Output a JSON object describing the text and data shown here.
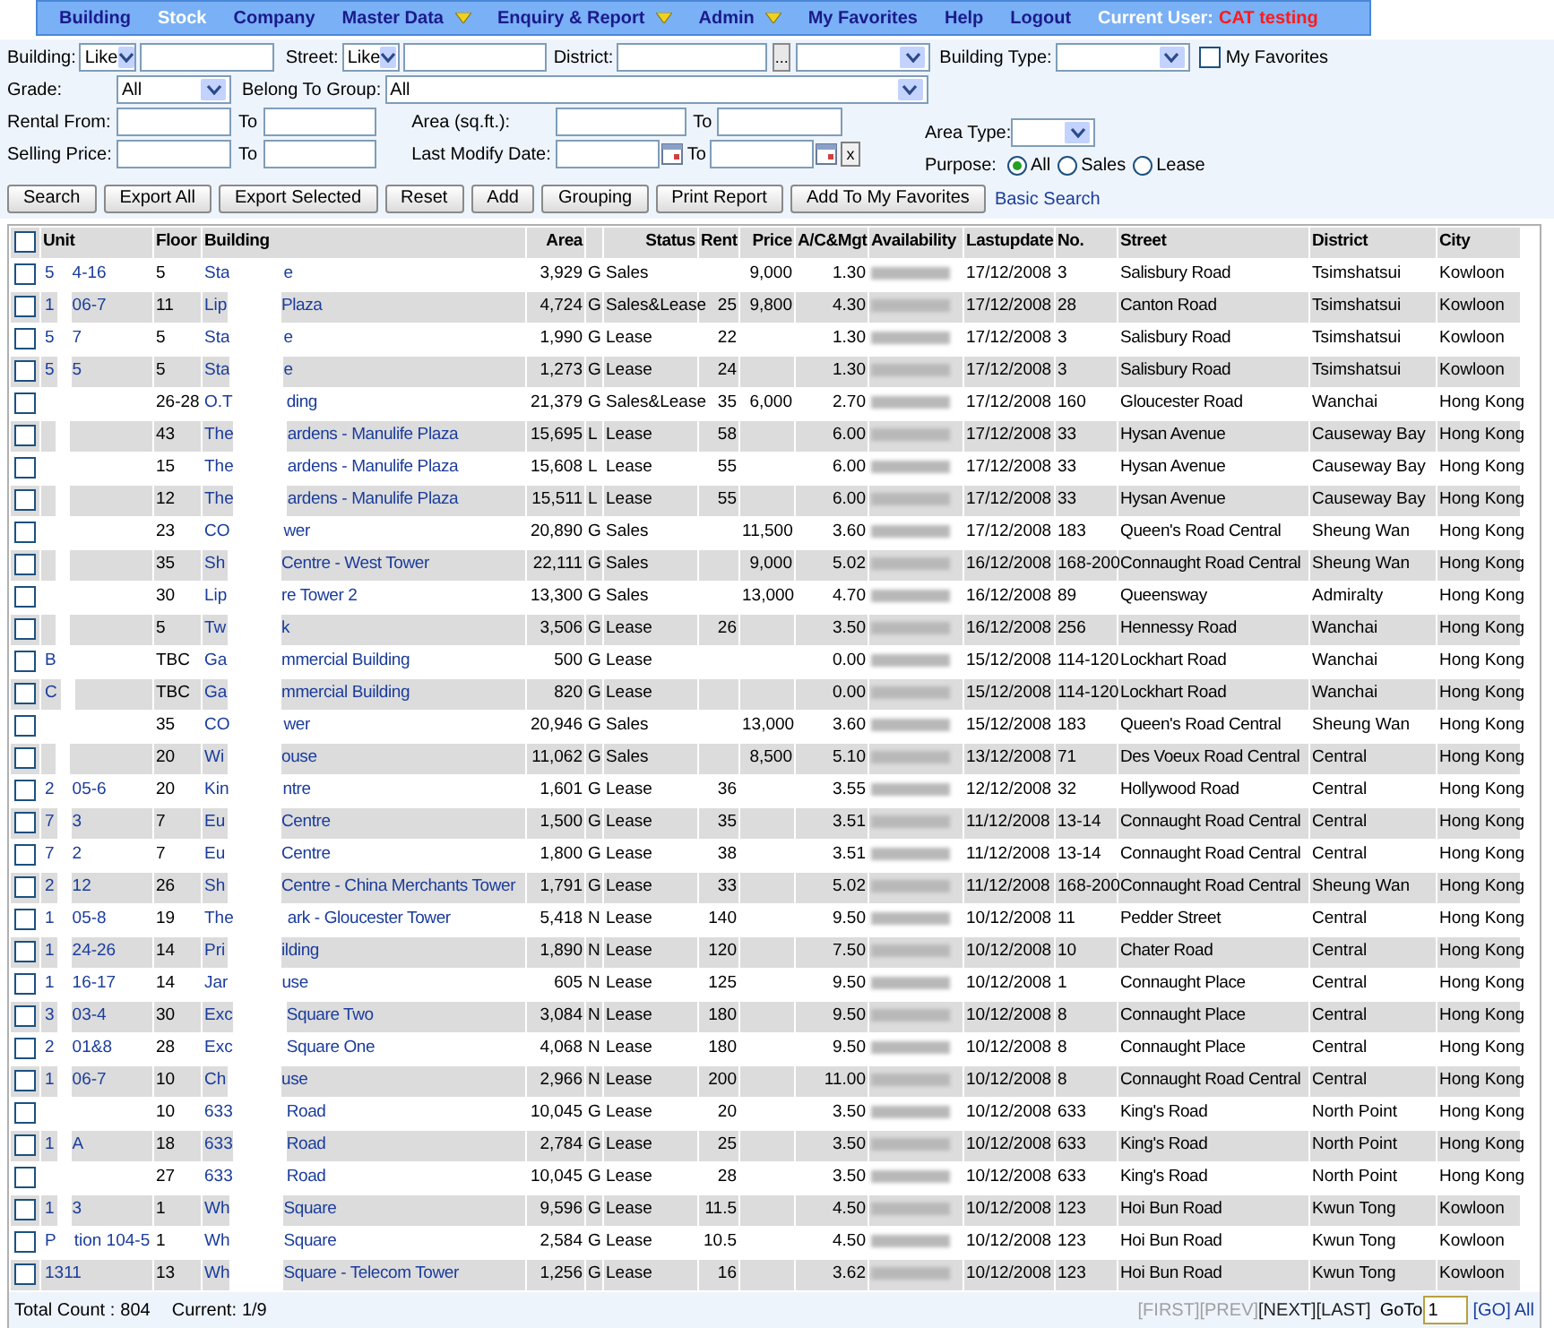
{
  "nav": {
    "items": [
      {
        "label": "Building",
        "selected": false,
        "dropdown": false
      },
      {
        "label": "Stock",
        "selected": true,
        "dropdown": false
      },
      {
        "label": "Company",
        "selected": false,
        "dropdown": false
      },
      {
        "label": "Master Data",
        "selected": false,
        "dropdown": true
      },
      {
        "label": "Enquiry & Report",
        "selected": false,
        "dropdown": true
      },
      {
        "label": "Admin",
        "selected": false,
        "dropdown": true
      },
      {
        "label": "My Favorites",
        "selected": false,
        "dropdown": false
      },
      {
        "label": "Help",
        "selected": false,
        "dropdown": false
      },
      {
        "label": "Logout",
        "selected": false,
        "dropdown": false
      }
    ],
    "current_user_label": "Current User:",
    "current_user": "CAT testing"
  },
  "filters": {
    "building_label": "Building:",
    "building_op": "Like",
    "street_label": "Street:",
    "street_op": "Like",
    "district_label": "District:",
    "district_button": "...",
    "building_type_label": "Building Type:",
    "my_favorites": {
      "label": "My Favorites",
      "checked": false
    },
    "grade_label": "Grade:",
    "grade": "All",
    "group_label": "Belong To Group:",
    "group": "All",
    "rental_label": "Rental From:",
    "rental_to_label": "To",
    "area_label": "Area (sq.ft.):",
    "area_to_label": "To",
    "selling_label": "Selling Price:",
    "selling_to_label": "To",
    "date_label": "Last Modify Date:",
    "date_to_label": "To",
    "clear_button": "x",
    "area_type_label": "Area Type:",
    "purpose_label": "Purpose:",
    "purpose_options": [
      {
        "label": "All",
        "selected": true
      },
      {
        "label": "Sales",
        "selected": false
      },
      {
        "label": "Lease",
        "selected": false
      }
    ]
  },
  "buttons": [
    "Search",
    "Export All",
    "Export Selected",
    "Reset",
    "Add",
    "Grouping",
    "Print Report",
    "Add To My Favorites"
  ],
  "basic_search": "Basic Search",
  "table": {
    "select_all_checked": false,
    "columns": [
      "Unit",
      "Floor",
      "Building",
      "Area",
      "Status",
      "Rent",
      "Price",
      "A/C&Mgt",
      "Availability",
      "Lastupdate",
      "No.",
      "Street",
      "District",
      "City"
    ],
    "rows": [
      {
        "checked": false,
        "unit_masked": true,
        "unit_a": "5",
        "unit_b": "4-16",
        "floor": "5",
        "bldg_a": "Sta",
        "bldg_b": "e",
        "area": "3,929",
        "grade": "G",
        "status": "Sales",
        "price": "9,000",
        "acm": "1.30",
        "updated": "17/12/2008",
        "no": "3",
        "street": "Salisbury Road",
        "district": "Tsimshatsui",
        "city": "Kowloon"
      },
      {
        "checked": false,
        "unit_masked": true,
        "unit_a": "1",
        "unit_b": "06-7",
        "floor": "11",
        "bldg_a": "Lip",
        "bldg_b": "Plaza",
        "area": "4,724",
        "grade": "G",
        "status": "Sales&Lease",
        "rent": "25",
        "price": "9,800",
        "acm": "4.30",
        "updated": "17/12/2008",
        "no": "28",
        "street": "Canton Road",
        "district": "Tsimshatsui",
        "city": "Kowloon"
      },
      {
        "checked": false,
        "unit_masked": true,
        "unit_a": "5",
        "unit_b": "7",
        "floor": "5",
        "bldg_a": "Sta",
        "bldg_b": "e",
        "area": "1,990",
        "grade": "G",
        "status": "Lease",
        "rent": "22",
        "acm": "1.30",
        "updated": "17/12/2008",
        "no": "3",
        "street": "Salisbury Road",
        "district": "Tsimshatsui",
        "city": "Kowloon"
      },
      {
        "checked": false,
        "unit_masked": true,
        "unit_a": "5",
        "unit_b": "5",
        "floor": "5",
        "bldg_a": "Sta",
        "bldg_b": "e",
        "area": "1,273",
        "grade": "G",
        "status": "Lease",
        "rent": "24",
        "acm": "1.30",
        "updated": "17/12/2008",
        "no": "3",
        "street": "Salisbury Road",
        "district": "Tsimshatsui",
        "city": "Kowloon"
      },
      {
        "checked": false,
        "unit_masked": true,
        "floor": "26-28",
        "bldg_a": "O.T",
        "bldg_b": "ding",
        "area": "21,379",
        "grade": "G",
        "status": "Sales&Lease",
        "rent": "35",
        "price": "6,000",
        "acm": "2.70",
        "updated": "17/12/2008",
        "no": "160",
        "street": "Gloucester Road",
        "district": "Wanchai",
        "city": "Hong Kong"
      },
      {
        "checked": false,
        "unit_masked": true,
        "floor": "43",
        "bldg_a": "The",
        "bldg_b": "ardens - Manulife Plaza",
        "area": "15,695",
        "grade": "L",
        "status": "Lease",
        "rent": "58",
        "acm": "6.00",
        "updated": "17/12/2008",
        "no": "33",
        "street": "Hysan Avenue",
        "district": "Causeway Bay",
        "city": "Hong Kong"
      },
      {
        "checked": false,
        "unit_masked": true,
        "floor": "15",
        "bldg_a": "The",
        "bldg_b": "ardens - Manulife Plaza",
        "area": "15,608",
        "grade": "L",
        "status": "Lease",
        "rent": "55",
        "acm": "6.00",
        "updated": "17/12/2008",
        "no": "33",
        "street": "Hysan Avenue",
        "district": "Causeway Bay",
        "city": "Hong Kong"
      },
      {
        "checked": false,
        "unit_masked": true,
        "floor": "12",
        "bldg_a": "The",
        "bldg_b": "ardens - Manulife Plaza",
        "area": "15,511",
        "grade": "L",
        "status": "Lease",
        "rent": "55",
        "acm": "6.00",
        "updated": "17/12/2008",
        "no": "33",
        "street": "Hysan Avenue",
        "district": "Causeway Bay",
        "city": "Hong Kong"
      },
      {
        "checked": false,
        "unit_masked": true,
        "floor": "23",
        "bldg_a": "CO",
        "bldg_b": "wer",
        "area": "20,890",
        "grade": "G",
        "status": "Sales",
        "price": "11,500",
        "acm": "3.60",
        "updated": "17/12/2008",
        "no": "183",
        "street": "Queen's Road Central",
        "district": "Sheung Wan",
        "city": "Hong Kong"
      },
      {
        "checked": false,
        "unit_masked": true,
        "floor": "35",
        "bldg_a": "Sh",
        "bldg_b": "Centre - West Tower",
        "area": "22,111",
        "grade": "G",
        "status": "Sales",
        "price": "9,000",
        "acm": "5.02",
        "updated": "16/12/2008",
        "no": "168-200",
        "street": "Connaught Road Central",
        "district": "Sheung Wan",
        "city": "Hong Kong"
      },
      {
        "checked": false,
        "unit_masked": true,
        "floor": "30",
        "bldg_a": "Lip",
        "bldg_b": "re Tower 2",
        "area": "13,300",
        "grade": "G",
        "status": "Sales",
        "price": "13,000",
        "acm": "4.70",
        "updated": "16/12/2008",
        "no": "89",
        "street": "Queensway",
        "district": "Admiralty",
        "city": "Hong Kong"
      },
      {
        "checked": false,
        "unit_masked": true,
        "floor": "5",
        "bldg_a": "Tw",
        "bldg_b": "k",
        "area": "3,506",
        "grade": "G",
        "status": "Lease",
        "rent": "26",
        "acm": "3.50",
        "updated": "16/12/2008",
        "no": "256",
        "street": "Hennessy Road",
        "district": "Wanchai",
        "city": "Hong Kong"
      },
      {
        "checked": false,
        "unit_masked": true,
        "unit_a": "B",
        "floor": "TBC",
        "bldg_a": "Ga",
        "bldg_b": "mmercial Building",
        "area": "500",
        "grade": "G",
        "status": "Lease",
        "acm": "0.00",
        "updated": "15/12/2008",
        "no": "114-120",
        "street": "Lockhart Road",
        "district": "Wanchai",
        "city": "Hong Kong"
      },
      {
        "checked": false,
        "unit_masked": true,
        "unit_a": "C",
        "floor": "TBC",
        "bldg_a": "Ga",
        "bldg_b": "mmercial Building",
        "area": "820",
        "grade": "G",
        "status": "Lease",
        "acm": "0.00",
        "updated": "15/12/2008",
        "no": "114-120",
        "street": "Lockhart Road",
        "district": "Wanchai",
        "city": "Hong Kong"
      },
      {
        "checked": false,
        "unit_masked": true,
        "floor": "35",
        "bldg_a": "CO",
        "bldg_b": "wer",
        "area": "20,946",
        "grade": "G",
        "status": "Sales",
        "price": "13,000",
        "acm": "3.60",
        "updated": "15/12/2008",
        "no": "183",
        "street": "Queen's Road Central",
        "district": "Sheung Wan",
        "city": "Hong Kong"
      },
      {
        "checked": false,
        "unit_masked": true,
        "floor": "20",
        "bldg_a": "Wi",
        "bldg_b": "ouse",
        "area": "11,062",
        "grade": "G",
        "status": "Sales",
        "price": "8,500",
        "acm": "5.10",
        "updated": "13/12/2008",
        "no": "71",
        "street": "Des Voeux Road Central",
        "district": "Central",
        "city": "Hong Kong"
      },
      {
        "checked": false,
        "unit_masked": true,
        "unit_a": "2",
        "unit_b": "05-6",
        "floor": "20",
        "bldg_a": "Kin",
        "bldg_b": "ntre",
        "area": "1,601",
        "grade": "G",
        "status": "Lease",
        "rent": "36",
        "acm": "3.55",
        "updated": "12/12/2008",
        "no": "32",
        "street": "Hollywood Road",
        "district": "Central",
        "city": "Hong Kong"
      },
      {
        "checked": false,
        "unit_masked": true,
        "unit_a": "7",
        "unit_b": "3",
        "floor": "7",
        "bldg_a": "Eu",
        "bldg_b": "Centre",
        "area": "1,500",
        "grade": "G",
        "status": "Lease",
        "rent": "35",
        "acm": "3.51",
        "updated": "11/12/2008",
        "no": "13-14",
        "street": "Connaught Road Central",
        "district": "Central",
        "city": "Hong Kong"
      },
      {
        "checked": false,
        "unit_masked": true,
        "unit_a": "7",
        "unit_b": "2",
        "floor": "7",
        "bldg_a": "Eu",
        "bldg_b": "Centre",
        "area": "1,800",
        "grade": "G",
        "status": "Lease",
        "rent": "38",
        "acm": "3.51",
        "updated": "11/12/2008",
        "no": "13-14",
        "street": "Connaught Road Central",
        "district": "Central",
        "city": "Hong Kong"
      },
      {
        "checked": false,
        "unit_masked": true,
        "unit_a": "2",
        "unit_b": "12",
        "floor": "26",
        "bldg_a": "Sh",
        "bldg_b": "Centre - China Merchants Tower",
        "area": "1,791",
        "grade": "G",
        "status": "Lease",
        "rent": "33",
        "acm": "5.02",
        "updated": "11/12/2008",
        "no": "168-200",
        "street": "Connaught Road Central",
        "district": "Sheung Wan",
        "city": "Hong Kong"
      },
      {
        "checked": false,
        "unit_masked": true,
        "unit_a": "1",
        "unit_b": "05-8",
        "floor": "19",
        "bldg_a": "The",
        "bldg_b": "ark - Gloucester Tower",
        "area": "5,418",
        "grade": "N",
        "status": "Lease",
        "rent": "140",
        "acm": "9.50",
        "updated": "10/12/2008",
        "no": "11",
        "street": "Pedder Street",
        "district": "Central",
        "city": "Hong Kong"
      },
      {
        "checked": false,
        "unit_masked": true,
        "unit_a": "1",
        "unit_b": "24-26",
        "floor": "14",
        "bldg_a": "Pri",
        "bldg_b": "ilding",
        "area": "1,890",
        "grade": "N",
        "status": "Lease",
        "rent": "120",
        "acm": "7.50",
        "updated": "10/12/2008",
        "no": "10",
        "street": "Chater Road",
        "district": "Central",
        "city": "Hong Kong"
      },
      {
        "checked": false,
        "unit_masked": true,
        "unit_a": "1",
        "unit_b": "16-17",
        "floor": "14",
        "bldg_a": "Jar",
        "bldg_b": "use",
        "area": "605",
        "grade": "N",
        "status": "Lease",
        "rent": "125",
        "acm": "9.50",
        "updated": "10/12/2008",
        "no": "1",
        "street": "Connaught Place",
        "district": "Central",
        "city": "Hong Kong"
      },
      {
        "checked": false,
        "unit_masked": true,
        "unit_a": "3",
        "unit_b": "03-4",
        "floor": "30",
        "bldg_a": "Exc",
        "bldg_b": "Square Two",
        "area": "3,084",
        "grade": "N",
        "status": "Lease",
        "rent": "180",
        "acm": "9.50",
        "updated": "10/12/2008",
        "no": "8",
        "street": "Connaught Place",
        "district": "Central",
        "city": "Hong Kong"
      },
      {
        "checked": false,
        "unit_masked": true,
        "unit_a": "2",
        "unit_b": "01&8",
        "floor": "28",
        "bldg_a": "Exc",
        "bldg_b": "Square One",
        "area": "4,068",
        "grade": "N",
        "status": "Lease",
        "rent": "180",
        "acm": "9.50",
        "updated": "10/12/2008",
        "no": "8",
        "street": "Connaught Place",
        "district": "Central",
        "city": "Hong Kong"
      },
      {
        "checked": false,
        "unit_masked": true,
        "unit_a": "1",
        "unit_b": "06-7",
        "floor": "10",
        "bldg_a": "Ch",
        "bldg_b": "use",
        "area": "2,966",
        "grade": "N",
        "status": "Lease",
        "rent": "200",
        "acm": "11.00",
        "updated": "10/12/2008",
        "no": "8",
        "street": "Connaught Road Central",
        "district": "Central",
        "city": "Hong Kong"
      },
      {
        "checked": false,
        "unit_masked": true,
        "floor": "10",
        "bldg_a": "633",
        "bldg_b": "Road",
        "area": "10,045",
        "grade": "G",
        "status": "Lease",
        "rent": "20",
        "acm": "3.50",
        "updated": "10/12/2008",
        "no": "633",
        "street": "King's Road",
        "district": "North Point",
        "city": "Hong Kong"
      },
      {
        "checked": false,
        "unit_masked": true,
        "unit_a": "1",
        "unit_b": "A",
        "floor": "18",
        "bldg_a": "633",
        "bldg_b": "Road",
        "area": "2,784",
        "grade": "G",
        "status": "Lease",
        "rent": "25",
        "acm": "3.50",
        "updated": "10/12/2008",
        "no": "633",
        "street": "King's Road",
        "district": "North Point",
        "city": "Hong Kong"
      },
      {
        "checked": false,
        "unit_masked": true,
        "floor": "27",
        "bldg_a": "633",
        "bldg_b": "Road",
        "area": "10,045",
        "grade": "G",
        "status": "Lease",
        "rent": "28",
        "acm": "3.50",
        "updated": "10/12/2008",
        "no": "633",
        "street": "King's Road",
        "district": "North Point",
        "city": "Hong Kong"
      },
      {
        "checked": false,
        "unit_masked": true,
        "unit_a": "1",
        "unit_b": "3",
        "floor": "1",
        "bldg_a": "Wh",
        "bldg_b": "Square",
        "area": "9,596",
        "grade": "G",
        "status": "Lease",
        "rent": "11.5",
        "acm": "4.50",
        "updated": "10/12/2008",
        "no": "123",
        "street": "Hoi Bun Road",
        "district": "Kwun Tong",
        "city": "Kowloon"
      },
      {
        "checked": false,
        "unit_masked": true,
        "unit_a": "P",
        "unit_b": "tion 104-5",
        "floor": "1",
        "bldg_a": "Wh",
        "bldg_b": "Square",
        "area": "2,584",
        "grade": "G",
        "status": "Lease",
        "rent": "10.5",
        "acm": "4.50",
        "updated": "10/12/2008",
        "no": "123",
        "street": "Hoi Bun Road",
        "district": "Kwun Tong",
        "city": "Kowloon"
      },
      {
        "checked": false,
        "unit_masked": false,
        "unit_a": "1311",
        "floor": "13",
        "bldg_a": "Wh",
        "bldg_b": "Square - Telecom Tower",
        "area": "1,256",
        "grade": "G",
        "status": "Lease",
        "rent": "16",
        "acm": "3.62",
        "updated": "10/12/2008",
        "no": "123",
        "street": "Hoi Bun Road",
        "district": "Kwun Tong",
        "city": "Kowloon"
      }
    ]
  },
  "footer": {
    "total_label": "Total Count :",
    "total": "804",
    "current_label": "Current:",
    "current": "1/9",
    "pager": [
      {
        "label": "[FIRST]",
        "disabled": true
      },
      {
        "label": "[PREV]",
        "disabled": true
      },
      {
        "label": "[NEXT]",
        "disabled": false
      },
      {
        "label": "[LAST]",
        "disabled": false
      }
    ],
    "goto_label": "GoTo",
    "goto_value": "1",
    "go": "[GO]",
    "all": "All"
  }
}
